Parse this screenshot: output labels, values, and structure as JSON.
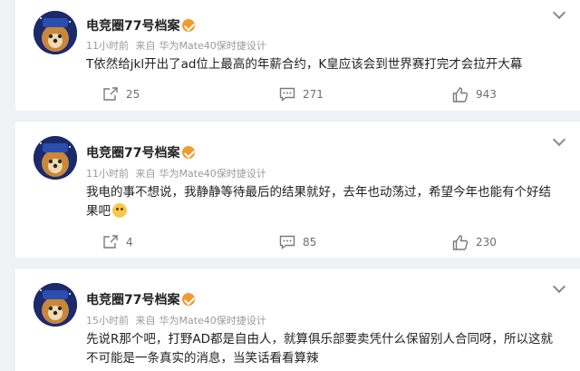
{
  "posts": [
    {
      "author": "电竞圈77号档案",
      "time": "11小时前",
      "source_prefix": "来自",
      "source": "华为Mate40保时捷设计",
      "text": "T依然给jkl开出了ad位上最高的年薪合约，K皇应该会到世界赛打完才会拉开大幕",
      "emoji_after_text": false,
      "reposts": "25",
      "comments": "271",
      "likes": "943"
    },
    {
      "author": "电竞圈77号档案",
      "time": "11小时前",
      "source_prefix": "来自",
      "source": "华为Mate40保时捷设计",
      "text_line1": "我电的事不想说，我静静等待最后的结果就好，去年也动荡过，希望今年也能有个好结",
      "text_line2": "果吧",
      "emoji_after_text": true,
      "reposts": "4",
      "comments": "85",
      "likes": "230"
    },
    {
      "author": "电竞圈77号档案",
      "time": "15小时前",
      "source_prefix": "来自",
      "source": "华为Mate40保时捷设计",
      "text_line1": "先说R那个吧，打野AD都是自由人，就算俱乐部要卖凭什么保留别人合同呀，所以这就",
      "text_line2": "不可能是一条真实的消息，当笑话看看算辣"
    }
  ],
  "icons": {
    "repost": "repost-icon",
    "comment": "comment-icon",
    "like": "thumbs-up-icon",
    "more": "chevron-down-icon",
    "verified": "vip-badge-icon"
  },
  "colors": {
    "background": "#f1f2f5",
    "card": "#ffffff",
    "meta_text": "#9a9a9a",
    "badge": "#f29a2e"
  }
}
